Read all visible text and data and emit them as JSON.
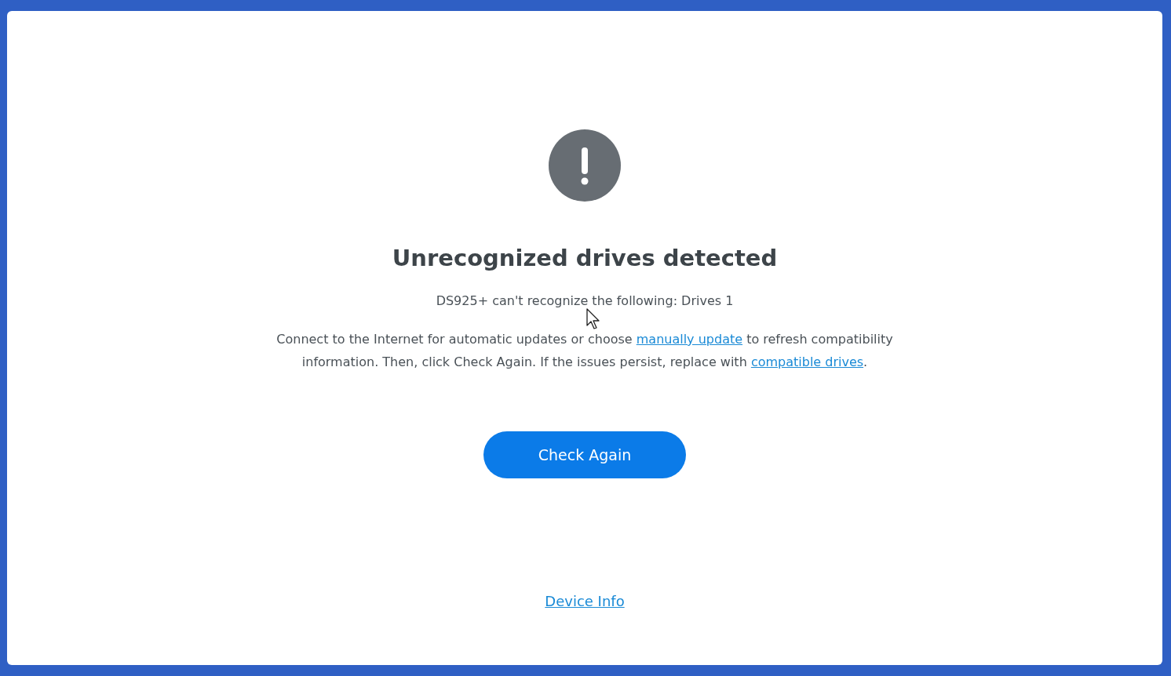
{
  "alert": {
    "kind": "warning"
  },
  "heading": "Unrecognized drives detected",
  "subtitle": "DS925+ can't recognize the following: Drives 1",
  "message": [
    {
      "kind": "text",
      "text": "Connect to the Internet for automatic updates or choose "
    },
    {
      "kind": "link",
      "text": "manually update"
    },
    {
      "kind": "text",
      "text": " to refresh compatibility information. Then, click Check Again. If the issues persist, replace with "
    },
    {
      "kind": "link",
      "text": "compatible drives"
    },
    {
      "kind": "text",
      "text": "."
    }
  ],
  "primary_button": "Check Again",
  "footer_link": "Device Info"
}
